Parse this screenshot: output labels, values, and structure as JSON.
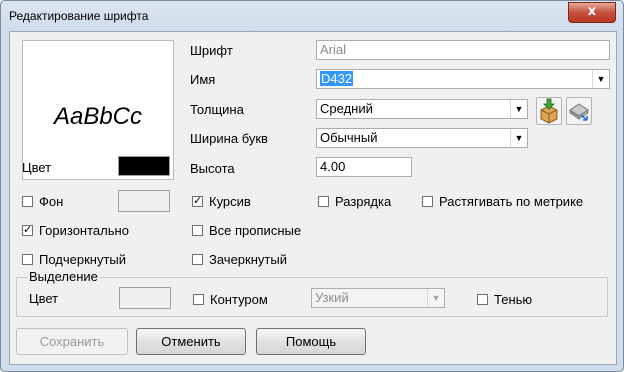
{
  "window": {
    "title": "Редактирование шрифта",
    "close_glyph": "x"
  },
  "preview": {
    "sample": "AaBbCc"
  },
  "color": {
    "label": "Цвет",
    "value": "#000000"
  },
  "font": {
    "label": "Шрифт",
    "value": "Arial"
  },
  "name": {
    "label": "Имя",
    "value": "D432"
  },
  "weight": {
    "label": "Толщина",
    "value": "Средний"
  },
  "width": {
    "label": "Ширина букв",
    "value": "Обычный"
  },
  "height": {
    "label": "Высота",
    "value": "4.00"
  },
  "background": {
    "label": "Фон",
    "checked": false
  },
  "horizontal": {
    "label": "Горизонтально",
    "checked": true
  },
  "underline": {
    "label": "Подчеркнутый",
    "checked": false
  },
  "italic": {
    "label": "Курсив",
    "checked": true
  },
  "all_caps": {
    "label": "Все прописные",
    "checked": false
  },
  "strikethrough": {
    "label": "Зачеркнутый",
    "checked": false
  },
  "spacing": {
    "label": "Разрядка",
    "checked": false
  },
  "stretch": {
    "label": "Растягивать по метрике",
    "checked": false
  },
  "highlight": {
    "legend": "Выделение",
    "color_label": "Цвет",
    "outline": {
      "label": "Контуром",
      "checked": false
    },
    "outline_type": "Узкий",
    "shadow": {
      "label": "Тенью",
      "checked": false
    }
  },
  "buttons": {
    "save": "Сохранить",
    "cancel": "Отменить",
    "help": "Помощь"
  },
  "icons": {
    "load": "box-arrow-down-icon",
    "save_style": "eraser-arrow-icon"
  },
  "colors": {
    "selection": "#3399ff",
    "close_button": "#c7503c"
  }
}
